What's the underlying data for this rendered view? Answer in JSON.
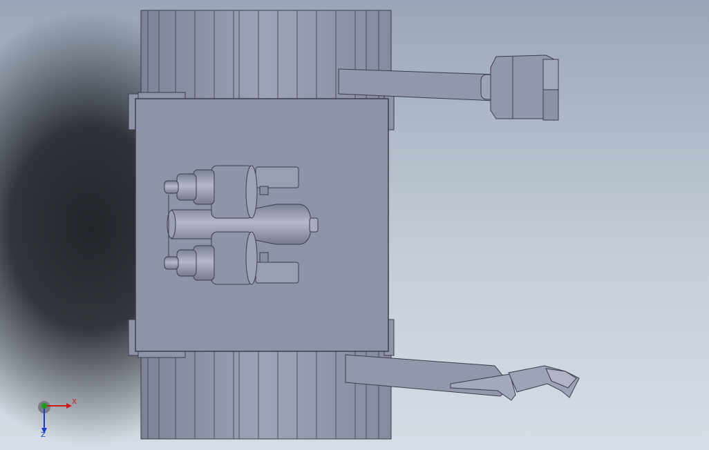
{
  "viewport": {
    "title": "",
    "background_top": "#9aa6b7",
    "background_bottom": "#d6dde6",
    "model_color": "#8e93a8",
    "edge_color": "#3a3c48"
  },
  "triad": {
    "x_label": "X",
    "z_label": "Z",
    "x_color": "#d01818",
    "y_color": "#18a018",
    "z_color": "#1a3ad0"
  }
}
